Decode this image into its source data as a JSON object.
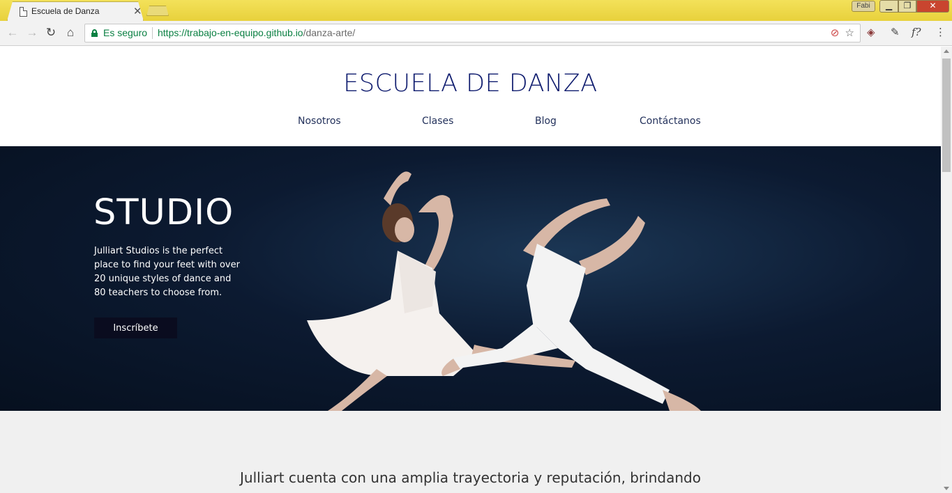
{
  "browser": {
    "tab_title": "Escuela de Danza",
    "tab_close": "✕",
    "profile": "Fabi",
    "security_label": "Es seguro",
    "url_host": "https://trabajo-en-equipo.github.io",
    "url_path": "/danza-arte/"
  },
  "site": {
    "title": "ESCUELA DE DANZA",
    "nav": [
      "Nosotros",
      "Clases",
      "Blog",
      "Contáctanos"
    ]
  },
  "hero": {
    "heading": "STUDIO",
    "text": "Julliart Studios is the perfect place to find your feet with over 20 unique styles of dance and 80 teachers to choose from.",
    "button": "Inscríbete"
  },
  "about": {
    "text": "Julliart cuenta con una amplia trayectoria y reputación, brindando"
  }
}
